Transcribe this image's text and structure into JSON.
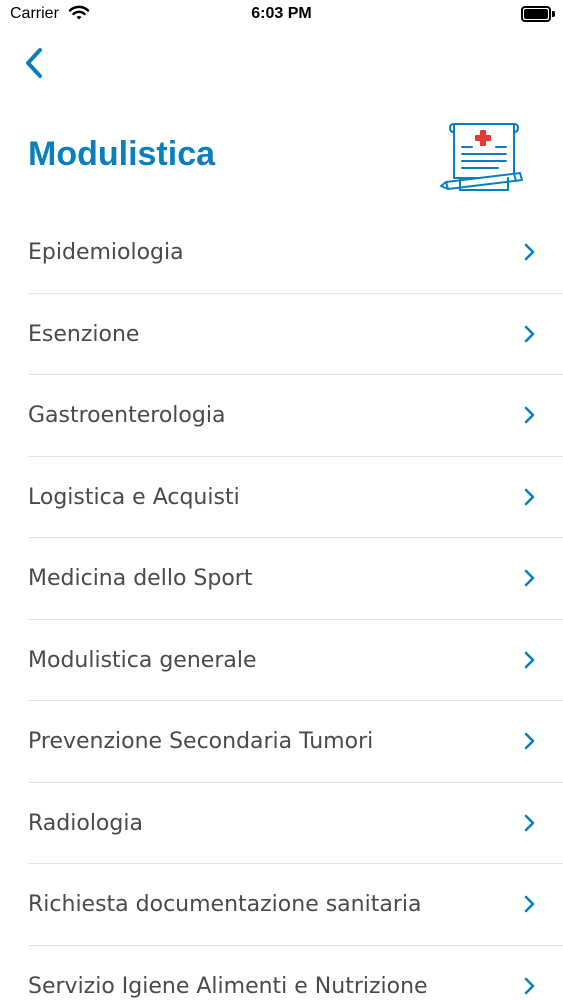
{
  "status_bar": {
    "carrier": "Carrier",
    "time": "6:03 PM",
    "icons": [
      "wifi-icon",
      "battery-icon"
    ]
  },
  "navigation": {
    "back_icon": "chevron-left-icon"
  },
  "header": {
    "title": "Modulistica",
    "illustration_icon": "medical-document-icon"
  },
  "list": {
    "items": [
      {
        "label": "Epidemiologia"
      },
      {
        "label": "Esenzione"
      },
      {
        "label": "Gastroenterologia"
      },
      {
        "label": "Logistica e Acquisti"
      },
      {
        "label": "Medicina dello Sport"
      },
      {
        "label": "Modulistica generale"
      },
      {
        "label": "Prevenzione Secondaria Tumori"
      },
      {
        "label": "Radiologia"
      },
      {
        "label": "Richiesta documentazione sanitaria"
      },
      {
        "label": "Servizio Igiene Alimenti e Nutrizione"
      }
    ],
    "chevron_icon": "chevron-right-icon"
  },
  "colors": {
    "accent": "#0a7fc0",
    "text": "#4a4a4a",
    "divider": "#e3e3e3",
    "medical_red": "#e53935"
  }
}
